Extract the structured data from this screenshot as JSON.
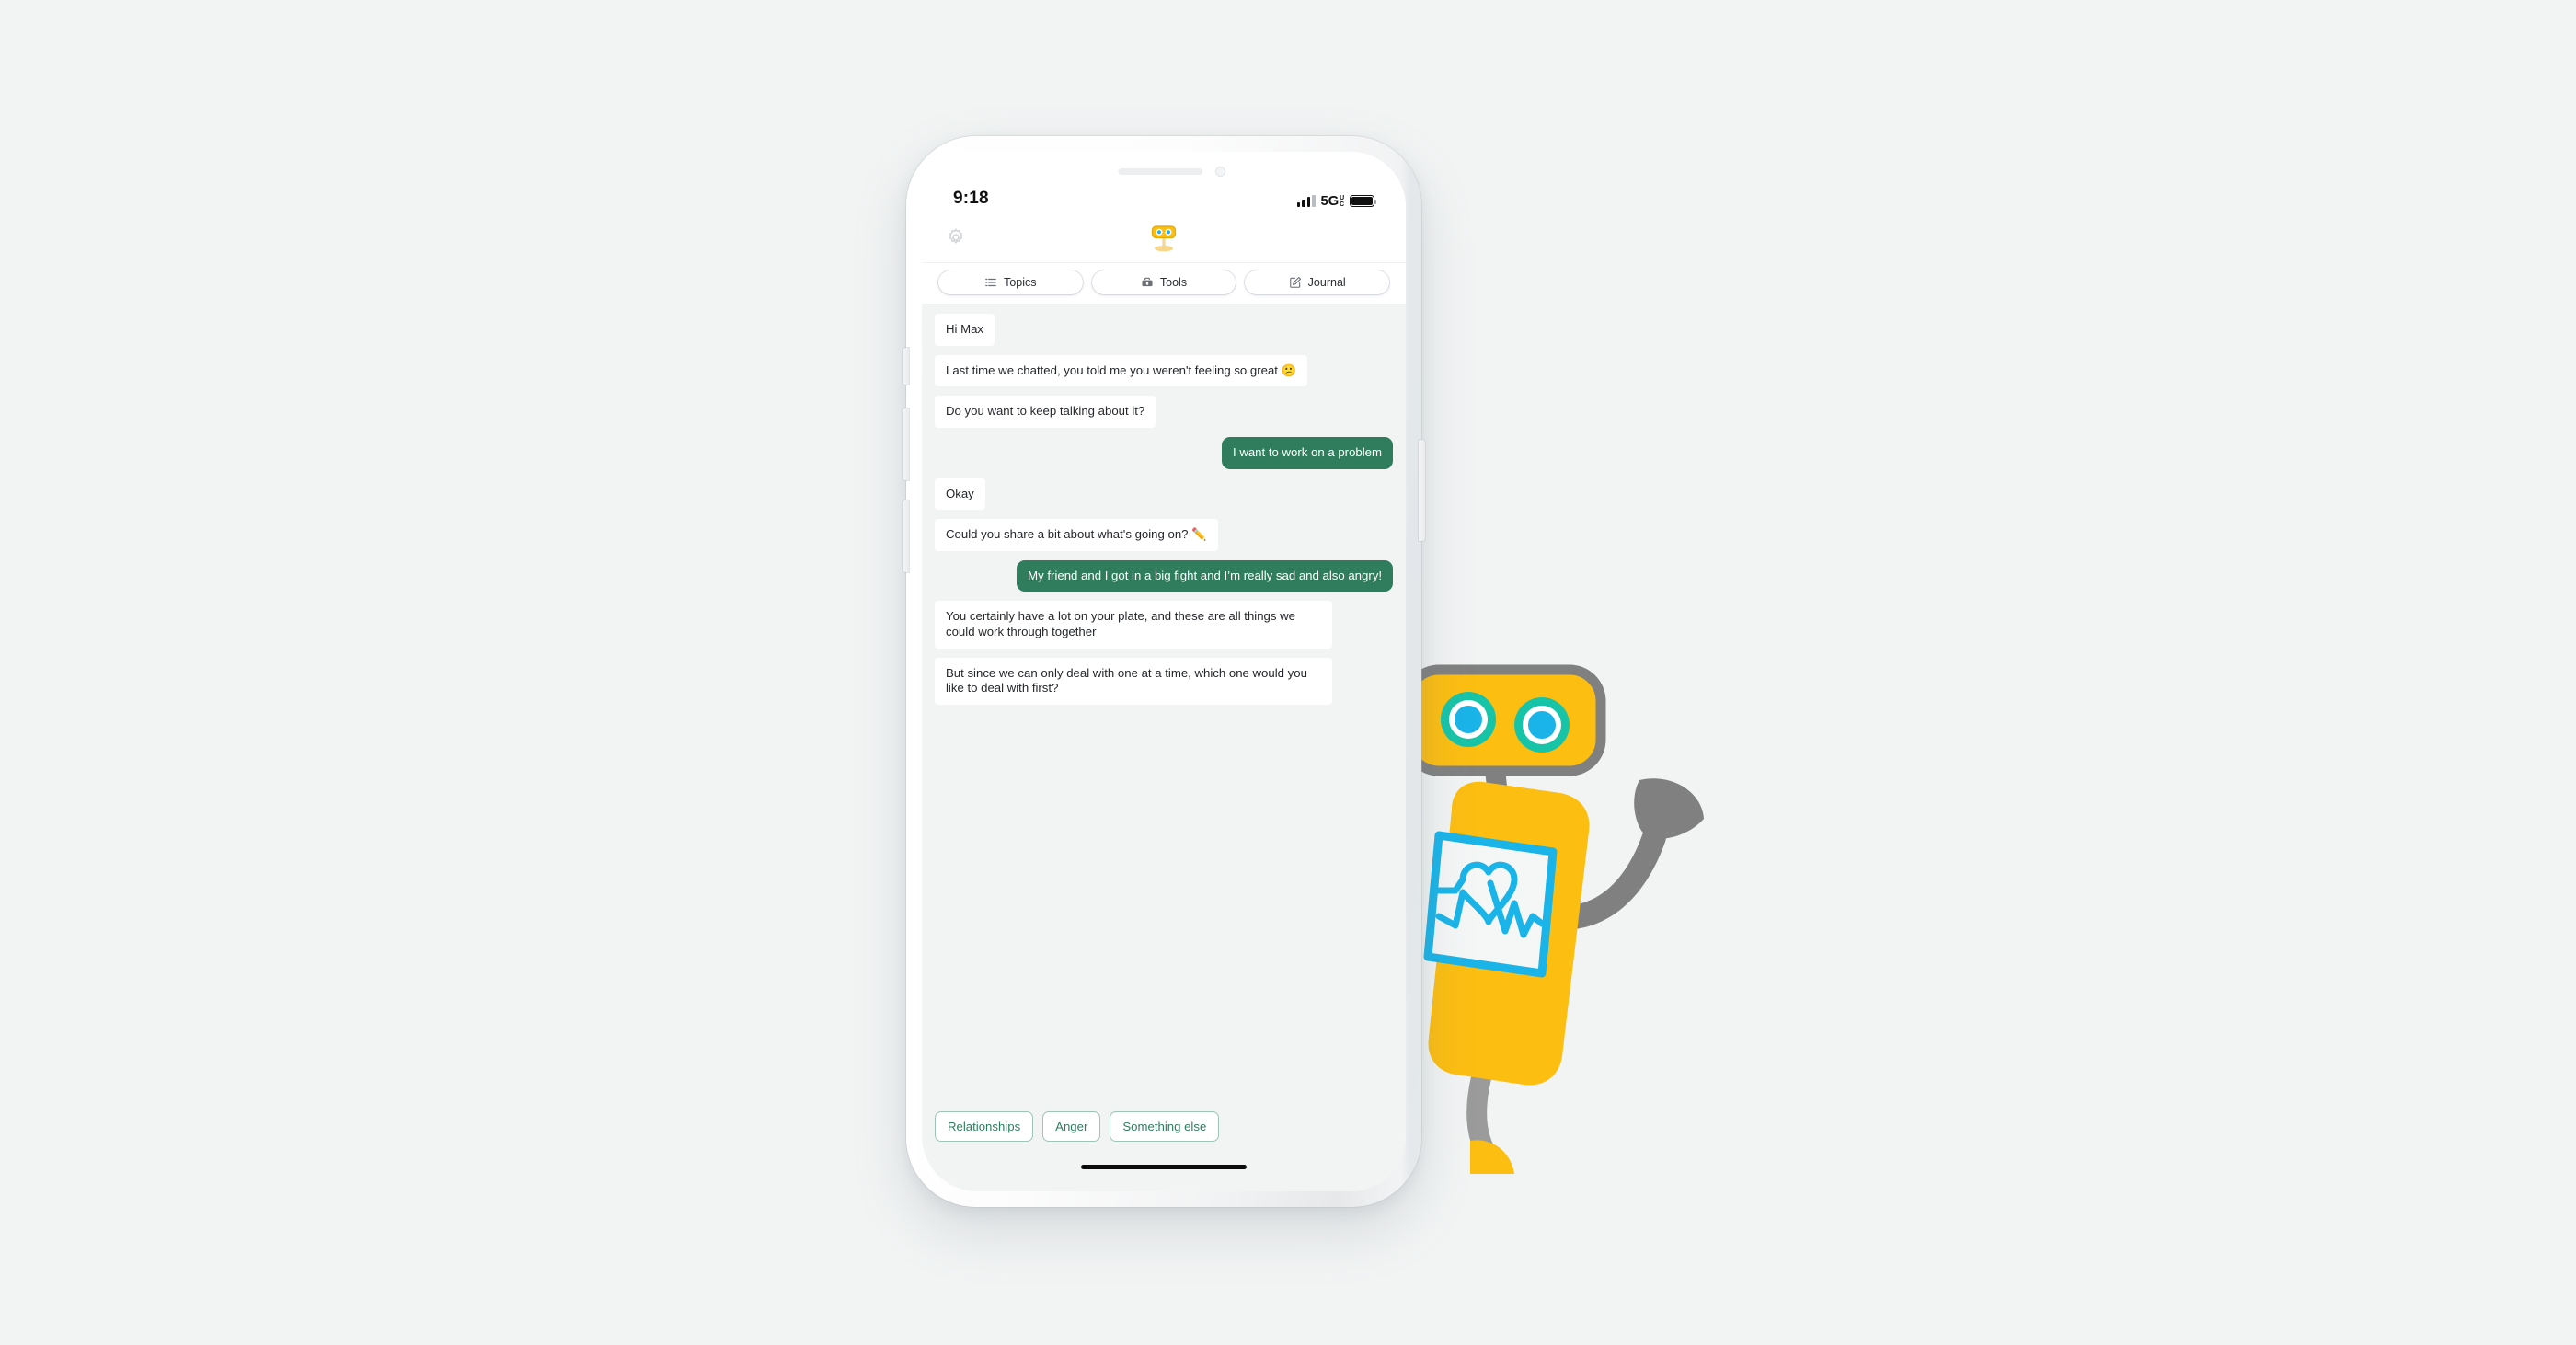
{
  "scene": {
    "background_color": "#f2f4f4",
    "mascot": {
      "name": "woebot-mascot",
      "head_color": "#fcbe11",
      "outline_color": "#808080",
      "eye_ring_color": "#18c4a8",
      "eye_pupil_color": "#1ab4e8",
      "screen_color": "#f5f7f7",
      "screen_border_color": "#1ab4e8",
      "heart_icon": "heart-with-heartbeat-line"
    }
  },
  "phone": {
    "frame_color": "#ffffff",
    "status_bar": {
      "time": "9:18",
      "network": "5G",
      "network_sup_top": "U",
      "network_sup_bottom": "C",
      "signal_icon": "cellular-bars-icon",
      "battery_icon": "battery-full-icon"
    },
    "home_indicator": "home-indicator"
  },
  "app": {
    "header": {
      "settings_icon": "gear-icon",
      "logo_icon": "robot-logo-icon"
    },
    "tabs": [
      {
        "label": "Topics",
        "icon": "list-icon"
      },
      {
        "label": "Tools",
        "icon": "toolbox-icon"
      },
      {
        "label": "Journal",
        "icon": "compose-square-icon"
      }
    ],
    "accent_color": "#2f7d5c",
    "messages": [
      {
        "sender": "bot",
        "text": "Hi Max"
      },
      {
        "sender": "bot",
        "text": "Last time we chatted, you told me you weren't feeling so great 😕"
      },
      {
        "sender": "bot",
        "text": "Do you want to keep talking about it?"
      },
      {
        "sender": "user",
        "text": "I want to work on a problem"
      },
      {
        "sender": "bot",
        "text": "Okay"
      },
      {
        "sender": "bot",
        "text": "Could you share a bit about what's going on? ✏️"
      },
      {
        "sender": "user",
        "text": "My friend and I got in a big fight and I’m really sad and also angry!"
      },
      {
        "sender": "bot",
        "text": "You certainly have a lot on your plate, and these are all things we could work through together"
      },
      {
        "sender": "bot",
        "text": "But since we can only deal with one at a time, which one would you like to deal with first?"
      }
    ],
    "quick_replies": [
      {
        "label": "Relationships"
      },
      {
        "label": "Anger"
      },
      {
        "label": "Something else"
      }
    ]
  }
}
